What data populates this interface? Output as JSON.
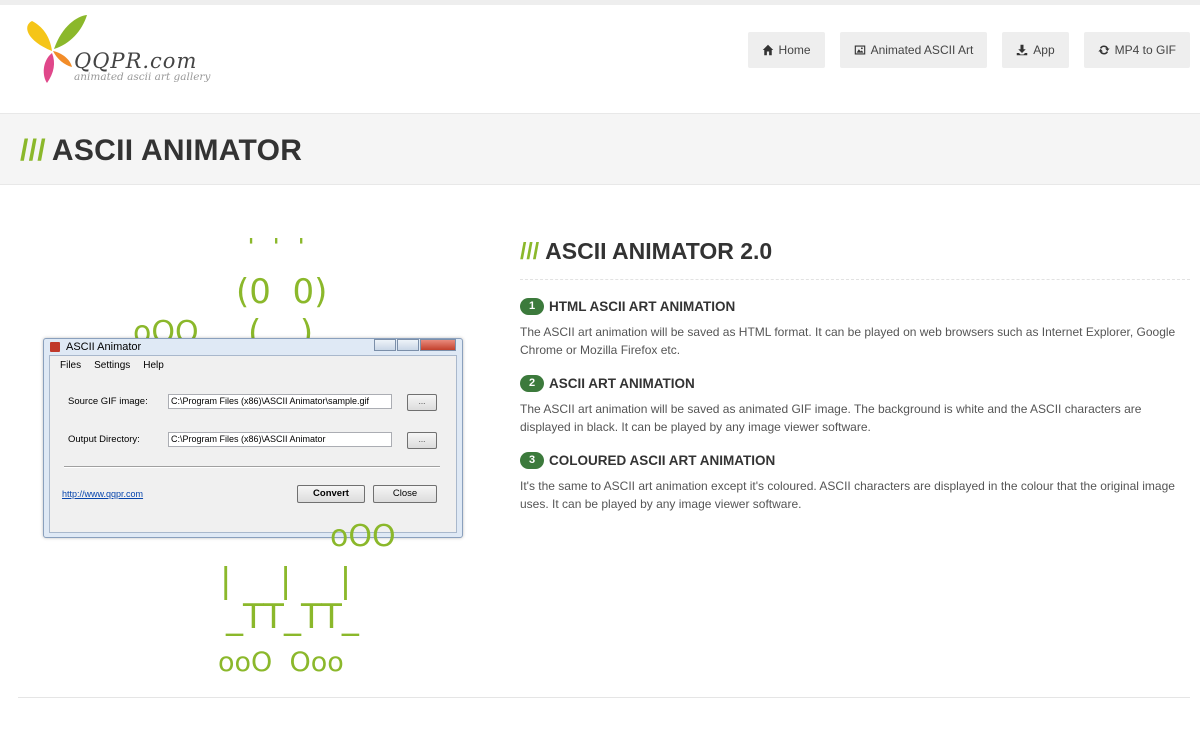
{
  "header": {
    "logo_text": "QQPR.com",
    "logo_tagline": "animated ascii art gallery",
    "nav": [
      {
        "label": "Home",
        "icon": "home-icon"
      },
      {
        "label": "Animated ASCII Art",
        "icon": "image-icon"
      },
      {
        "label": "App",
        "icon": "download-icon"
      },
      {
        "label": "MP4 to GIF",
        "icon": "refresh-icon"
      }
    ]
  },
  "page_title": {
    "slash": "///",
    "text": "ASCII ANIMATOR"
  },
  "ascii_art": {
    "hair": "' ' '",
    "eyes": "(0  0)",
    "mouth": "( _ )",
    "left_ooo": "oOO",
    "right_ooo": "oOO",
    "legs_top": "|   |   |",
    "legs_mid": "_TT_TT_",
    "feet": "ooO  Ooo"
  },
  "app_window": {
    "title": "ASCII Animator",
    "menu": [
      "Files",
      "Settings",
      "Help"
    ],
    "source_label": "Source GIF image:",
    "source_value": "C:\\Program Files (x86)\\ASCII Animator\\sample.gif",
    "output_label": "Output Directory:",
    "output_value": "C:\\Program Files (x86)\\ASCII Animator",
    "browse_label": "...",
    "link": "http://www.qqpr.com",
    "convert_label": "Convert",
    "close_label": "Close"
  },
  "content": {
    "heading_slash": "///",
    "heading": "ASCII ANIMATOR 2.0",
    "features": [
      {
        "num": "1",
        "title": "HTML ASCII ART ANIMATION",
        "text": "The ASCII art animation will be saved as HTML format. It can be played on web browsers such as Internet Explorer, Google Chrome or Mozilla Firefox etc."
      },
      {
        "num": "2",
        "title": "ASCII ART ANIMATION",
        "text": "The ASCII art animation will be saved as animated GIF image. The background is white and the ASCII characters are displayed in black. It can be played by any image viewer software."
      },
      {
        "num": "3",
        "title": "COLOURED ASCII ART ANIMATION",
        "text": "It's the same to ASCII art animation except it's coloured. ASCII characters are displayed in the colour that the original image uses. It can be played by any image viewer software."
      }
    ]
  },
  "colors": {
    "accent_green": "#8bb82b",
    "badge_green": "#3c7a3c"
  }
}
